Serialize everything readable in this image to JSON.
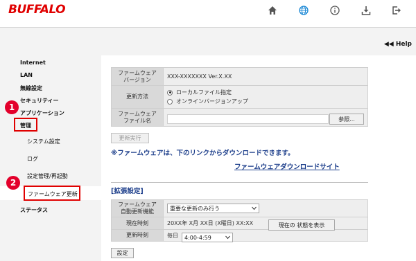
{
  "header": {
    "brand": "BUFFALO",
    "icons": [
      "home-icon",
      "globe-icon",
      "info-icon",
      "download-icon",
      "logout-icon"
    ],
    "colors": {
      "brand": "#e00000",
      "icon": "#555555",
      "globe": "#1e8ad6"
    }
  },
  "help": {
    "label": "Help"
  },
  "sidebar": {
    "items": [
      {
        "label": "Internet"
      },
      {
        "label": "LAN"
      },
      {
        "label": "無線設定"
      },
      {
        "label": "セキュリティー"
      },
      {
        "label": "アプリケーション"
      },
      {
        "label": "管理"
      },
      {
        "label": "システム設定"
      },
      {
        "label": "ログ"
      },
      {
        "label": "設定管理/再起動"
      },
      {
        "label": "ファームウェア更新"
      },
      {
        "label": "ステータス"
      }
    ],
    "badges": [
      "1",
      "2"
    ]
  },
  "firmware": {
    "version_label": "ファームウェア\nバージョン",
    "version_value": "XXX-XXXXXXX Ver.X.XX",
    "method_label": "更新方法",
    "method_options": [
      "ローカルファイル指定",
      "オンラインバージョンアップ"
    ],
    "file_label": "ファームウェア\nファイル名",
    "browse_button": "参照...",
    "execute_button": "更新実行"
  },
  "note": "※ファームウェアは、下のリンクからダウンロードできます。",
  "download_link": "ファームウェアダウンロードサイト",
  "extended": {
    "title": "[拡張設定]",
    "auto_label": "ファームウェア\n自動更新機能",
    "auto_value": "重要な更新のみ行う",
    "time_label": "現在時刻",
    "time_value": "20XX年 X月 XX日 (X曜日) XX:XX",
    "time_button": "現在の 状態を表示",
    "schedule_label": "更新時刻",
    "schedule_day": "毎日",
    "schedule_value": "4:00-4:59",
    "save_button": "設定"
  }
}
